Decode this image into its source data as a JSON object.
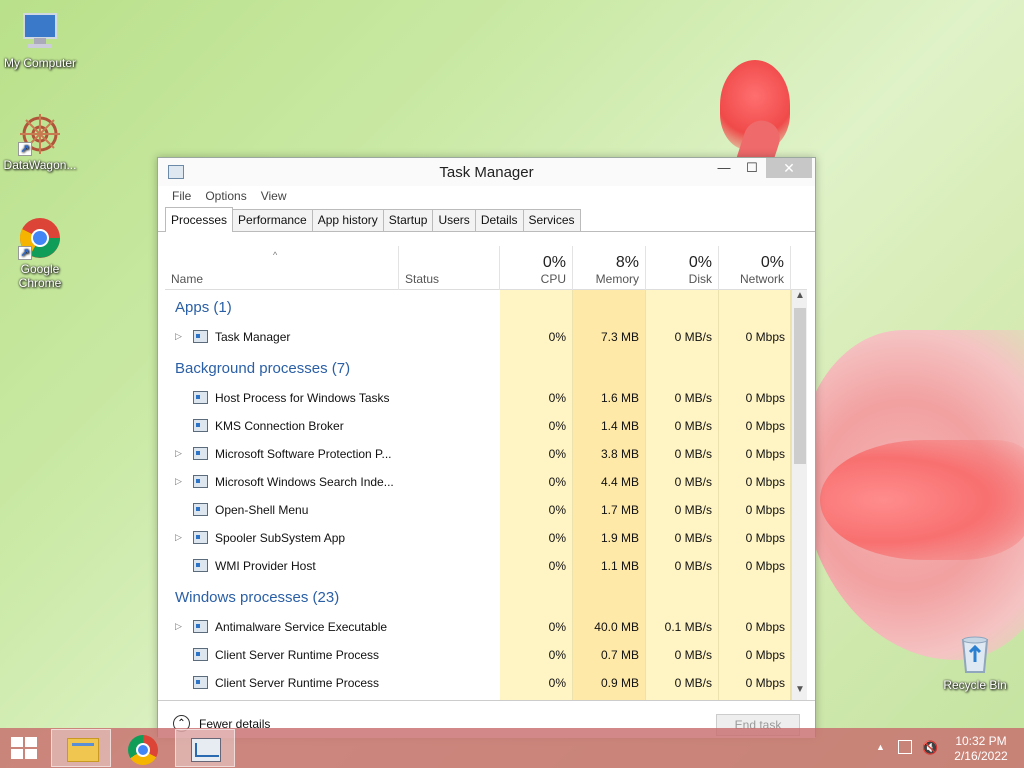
{
  "desktop": {
    "icons": [
      {
        "label": "My Computer"
      },
      {
        "label": "DataWagon..."
      },
      {
        "label": "Google Chrome"
      },
      {
        "label": "Recycle Bin"
      }
    ]
  },
  "window": {
    "title": "Task Manager",
    "menu": [
      "File",
      "Options",
      "View"
    ],
    "tabs": [
      "Processes",
      "Performance",
      "App history",
      "Startup",
      "Users",
      "Details",
      "Services"
    ],
    "active_tab": "Processes",
    "columns": {
      "name": "Name",
      "status": "Status",
      "cpu": {
        "label": "CPU",
        "total": "0%"
      },
      "memory": {
        "label": "Memory",
        "total": "8%"
      },
      "disk": {
        "label": "Disk",
        "total": "0%"
      },
      "network": {
        "label": "Network",
        "total": "0%"
      }
    },
    "groups": [
      {
        "title": "Apps (1)",
        "rows": [
          {
            "name": "Task Manager",
            "expandable": true,
            "cpu": "0%",
            "mem": "7.3 MB",
            "disk": "0 MB/s",
            "net": "0 Mbps"
          }
        ]
      },
      {
        "title": "Background processes (7)",
        "rows": [
          {
            "name": "Host Process for Windows Tasks",
            "expandable": false,
            "cpu": "0%",
            "mem": "1.6 MB",
            "disk": "0 MB/s",
            "net": "0 Mbps"
          },
          {
            "name": "KMS Connection Broker",
            "expandable": false,
            "cpu": "0%",
            "mem": "1.4 MB",
            "disk": "0 MB/s",
            "net": "0 Mbps"
          },
          {
            "name": "Microsoft Software Protection P...",
            "expandable": true,
            "cpu": "0%",
            "mem": "3.8 MB",
            "disk": "0 MB/s",
            "net": "0 Mbps"
          },
          {
            "name": "Microsoft Windows Search Inde...",
            "expandable": true,
            "cpu": "0%",
            "mem": "4.4 MB",
            "disk": "0 MB/s",
            "net": "0 Mbps"
          },
          {
            "name": "Open-Shell Menu",
            "expandable": false,
            "cpu": "0%",
            "mem": "1.7 MB",
            "disk": "0 MB/s",
            "net": "0 Mbps"
          },
          {
            "name": "Spooler SubSystem App",
            "expandable": true,
            "cpu": "0%",
            "mem": "1.9 MB",
            "disk": "0 MB/s",
            "net": "0 Mbps"
          },
          {
            "name": "WMI Provider Host",
            "expandable": false,
            "cpu": "0%",
            "mem": "1.1 MB",
            "disk": "0 MB/s",
            "net": "0 Mbps"
          }
        ]
      },
      {
        "title": "Windows processes (23)",
        "rows": [
          {
            "name": "Antimalware Service Executable",
            "expandable": true,
            "cpu": "0%",
            "mem": "40.0 MB",
            "disk": "0.1 MB/s",
            "net": "0 Mbps"
          },
          {
            "name": "Client Server Runtime Process",
            "expandable": false,
            "cpu": "0%",
            "mem": "0.7 MB",
            "disk": "0 MB/s",
            "net": "0 Mbps"
          },
          {
            "name": "Client Server Runtime Process",
            "expandable": false,
            "cpu": "0%",
            "mem": "0.9 MB",
            "disk": "0 MB/s",
            "net": "0 Mbps"
          }
        ]
      }
    ],
    "footer": {
      "fewer_details": "Fewer details",
      "end_task": "End task"
    }
  },
  "taskbar": {
    "clock_time": "10:32 PM",
    "clock_date": "2/16/2022"
  }
}
